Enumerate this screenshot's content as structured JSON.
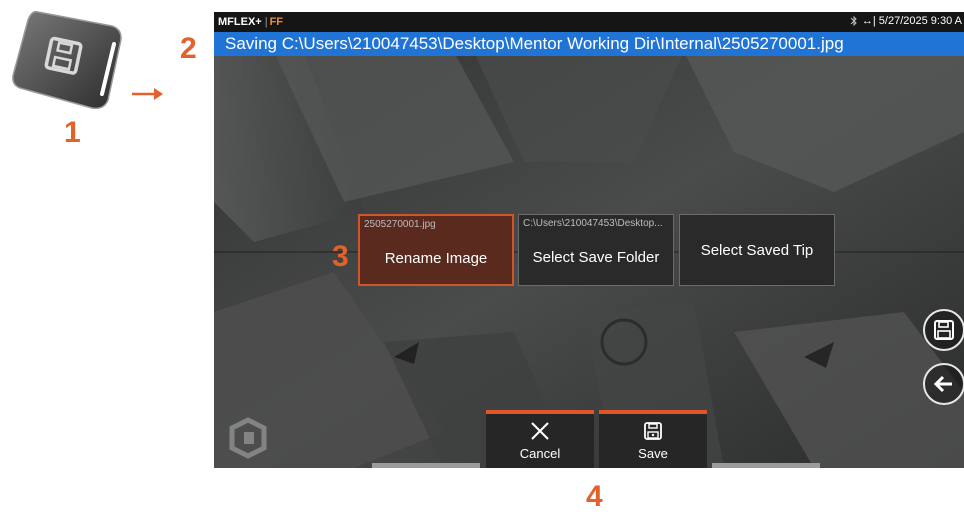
{
  "callouts": {
    "hardware_key": "1",
    "path_bar": "2",
    "rename_option": "3",
    "bottom_buttons": "4"
  },
  "status_bar": {
    "brand": "MFLEX+",
    "separator": "|",
    "mode": "FF",
    "datetime": "↔| 5/27/2025  9:30 A"
  },
  "save_path": "Saving C:\\Users\\210047453\\Desktop\\Mentor Working Dir\\Internal\\2505270001.jpg",
  "options": [
    {
      "sublabel": "2505270001.jpg",
      "label": "Rename Image",
      "selected": true
    },
    {
      "sublabel": "C:\\Users\\210047453\\Desktop...",
      "label": "Select Save Folder",
      "selected": false
    },
    {
      "sublabel": "",
      "label": "Select Saved Tip",
      "selected": false
    }
  ],
  "bottom_buttons": {
    "cancel_label": "Cancel",
    "save_label": "Save"
  },
  "icons": {
    "hardware_key": "floppy-disk-icon",
    "side_save": "floppy-disk-icon",
    "side_back": "arrow-left-icon",
    "cancel": "close-icon",
    "save": "floppy-disk-icon",
    "status": "bluetooth-icon"
  },
  "colors": {
    "accent_orange": "#e3612b",
    "path_bar_blue": "#1f74d6",
    "selected_border": "#d0552b"
  }
}
